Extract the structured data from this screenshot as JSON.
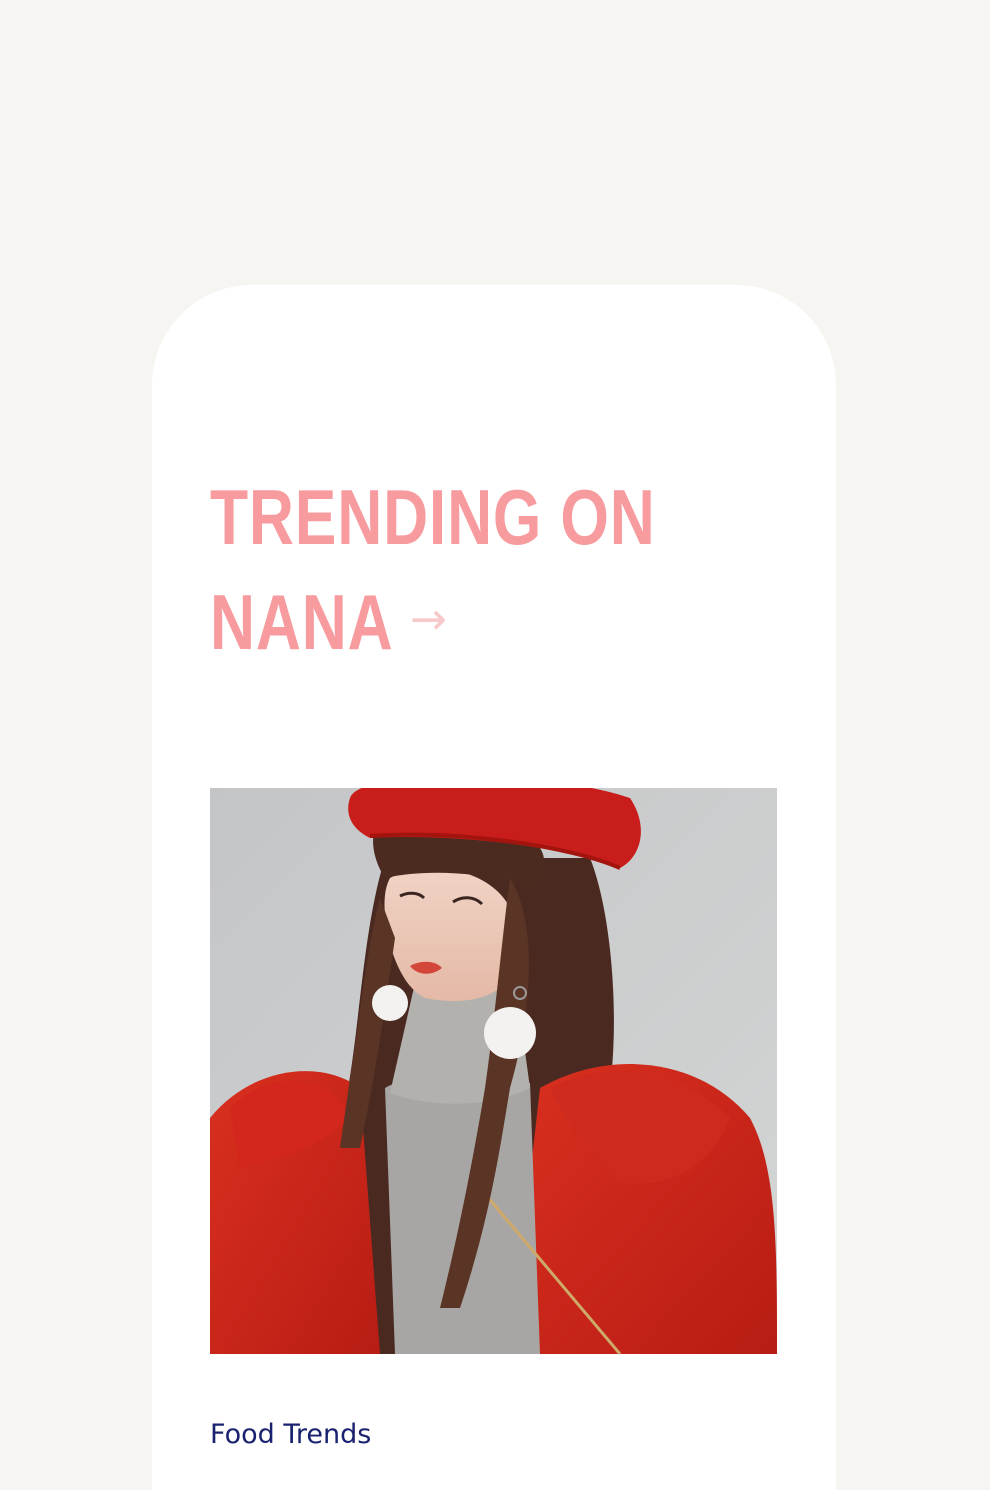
{
  "section": {
    "title_line1": "TRENDING ON",
    "title_line2": "NANA",
    "arrow_icon": "arrow-right-icon",
    "title_color": "#f79b9f",
    "arrow_color": "#f8c9cb"
  },
  "feature": {
    "image_icon": "fashion-photo",
    "category_label": "Food Trends",
    "category_color": "#1a2270"
  },
  "colors": {
    "page_background": "#f6f5f1",
    "card_background": "#ffffff"
  }
}
